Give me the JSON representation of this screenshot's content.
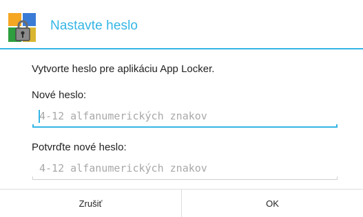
{
  "dialog": {
    "title": "Nastavte heslo",
    "icon": "app-locker-lock-icon",
    "accent_color": "#33b5e5",
    "prompt": "Vytvorte heslo pre aplikáciu App Locker.",
    "new_password": {
      "label": "Nové heslo:",
      "value": "",
      "placeholder": "4-12 alfanumerických znakov"
    },
    "confirm_password": {
      "label": "Potvrďte nové heslo:",
      "value": "",
      "placeholder": "4-12 alfanumerických znakov"
    },
    "buttons": {
      "cancel": "Zrušiť",
      "ok": "OK"
    }
  }
}
